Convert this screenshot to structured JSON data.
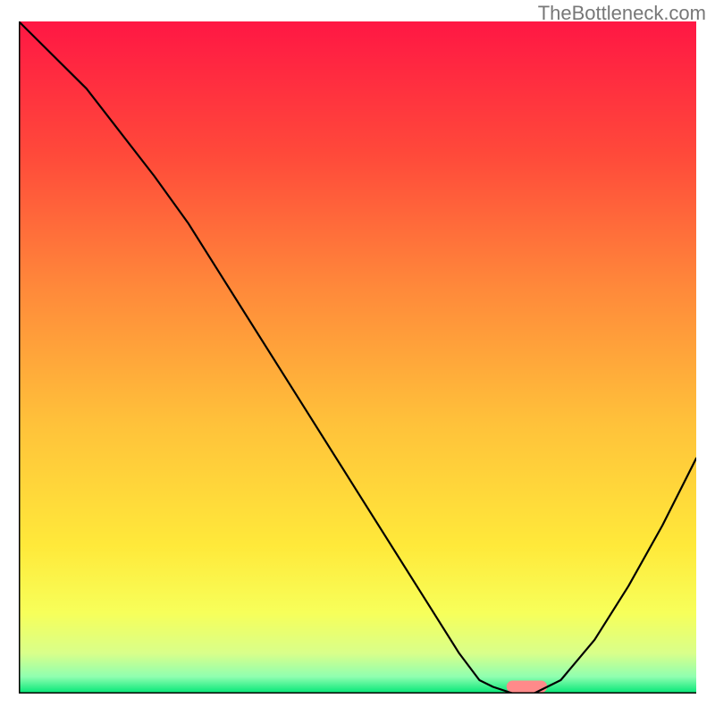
{
  "watermark": "TheBottleneck.com",
  "chart_data": {
    "type": "line",
    "title": "",
    "xlabel": "",
    "ylabel": "",
    "xlim": [
      0,
      100
    ],
    "ylim": [
      0,
      100
    ],
    "axes": {
      "left": true,
      "bottom": true,
      "ticks": false,
      "grid": false
    },
    "background": {
      "type": "vertical-gradient",
      "stops": [
        {
          "pos": 0.0,
          "color": "#ff1744"
        },
        {
          "pos": 0.2,
          "color": "#ff4a3a"
        },
        {
          "pos": 0.4,
          "color": "#ff8a3a"
        },
        {
          "pos": 0.6,
          "color": "#ffc23a"
        },
        {
          "pos": 0.78,
          "color": "#ffe93a"
        },
        {
          "pos": 0.88,
          "color": "#f7ff5a"
        },
        {
          "pos": 0.94,
          "color": "#d9ff8a"
        },
        {
          "pos": 0.975,
          "color": "#8fffb0"
        },
        {
          "pos": 1.0,
          "color": "#00e676"
        }
      ]
    },
    "series": [
      {
        "name": "curve",
        "color": "#000000",
        "x": [
          0,
          10,
          20,
          25,
          30,
          40,
          50,
          60,
          65,
          68,
          70,
          73,
          76,
          80,
          85,
          90,
          95,
          100
        ],
        "values": [
          100,
          90,
          77,
          70,
          62,
          46,
          30,
          14,
          6,
          2,
          1,
          0,
          0,
          2,
          8,
          16,
          25,
          35
        ]
      }
    ],
    "marker": {
      "name": "highlight-bar",
      "color": "#ff8a8a",
      "x_start": 72,
      "x_end": 78,
      "thickness": 1.0
    }
  }
}
